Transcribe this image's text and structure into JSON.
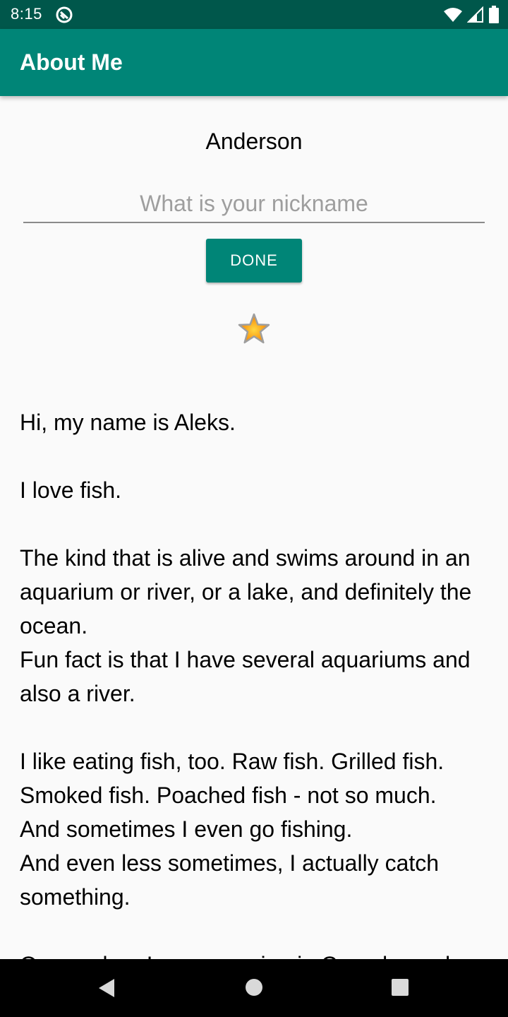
{
  "status_bar": {
    "time": "8:15",
    "icons": [
      "notification-icon",
      "wifi-icon",
      "signal-icon",
      "battery-icon"
    ]
  },
  "app_bar": {
    "title": "About Me"
  },
  "main": {
    "name": "Anderson",
    "nickname_placeholder": "What is your nickname",
    "nickname_value": "",
    "done_label": "DONE",
    "star_icon": "star-icon",
    "bio_text": "Hi, my name is Aleks.\n\nI love fish.\n\nThe kind that is alive and swims around in an aquarium or river, or a lake, and definitely the ocean.\nFun fact is that I have several aquariums and also a river.\n\nI like eating fish, too. Raw fish. Grilled fish. Smoked fish. Poached fish - not so much.\nAnd sometimes I even go fishing.\nAnd even less sometimes, I actually catch something.\n\nOnce, when I was camping in Canada, and"
  },
  "nav_bar": {
    "icons": [
      "back-icon",
      "home-icon",
      "recents-icon"
    ]
  },
  "colors": {
    "status_bar": "#00574b",
    "primary": "#008577",
    "background": "#fafafa"
  }
}
